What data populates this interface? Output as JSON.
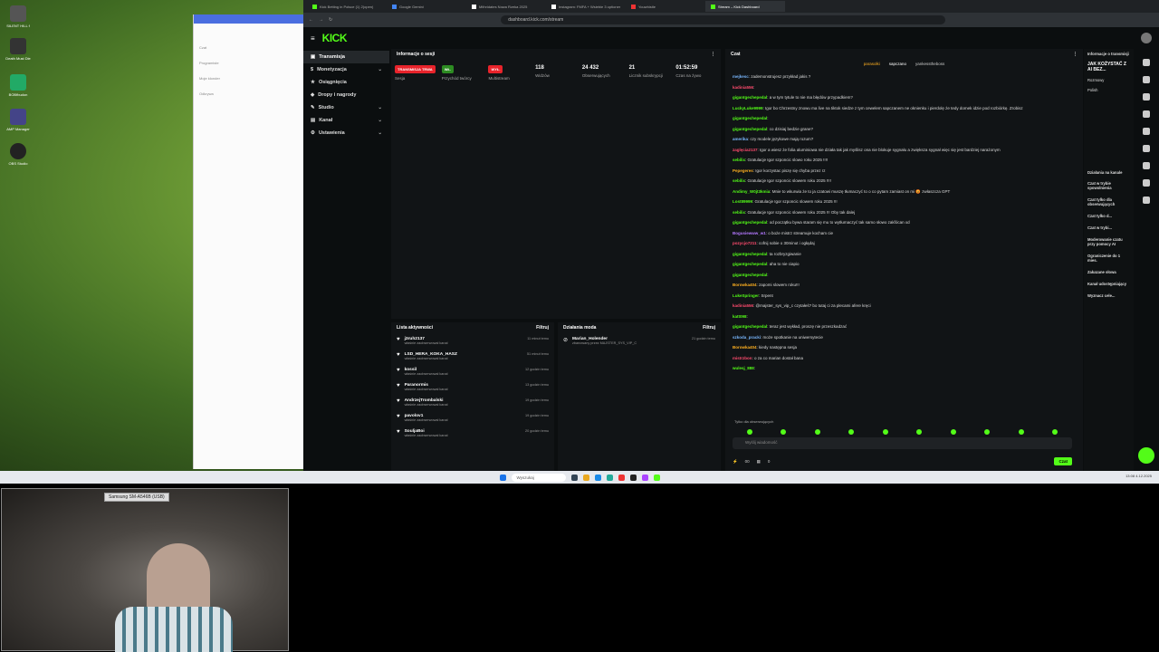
{
  "browser": {
    "tabs": [
      "Kick Betting in Polsce (1) 2(open)",
      "Google Gemini",
      "Mithridates Nowa Rzeka 2025",
      "Instagram: FMFA + Wsiebie 3 optioner",
      "Youwhistle",
      "Stream – Kick Dashboard"
    ],
    "url": "dashboard.kick.com/stream"
  },
  "nav": {
    "items": [
      {
        "label": "Transmisja",
        "chevron": ""
      },
      {
        "label": "Monetyzacja",
        "chevron": "⌄"
      },
      {
        "label": "Osiągnięcia",
        "chevron": ""
      },
      {
        "label": "Dropy i nagrody",
        "chevron": ""
      },
      {
        "label": "Studio",
        "chevron": "⌄"
      },
      {
        "label": "Kanał",
        "chevron": "⌄"
      },
      {
        "label": "Ustawienia",
        "chevron": "⌄"
      }
    ]
  },
  "session": {
    "title": "Informacje o sesji",
    "stats": [
      {
        "pill": "TRANSMISJA TRWA",
        "pill_color": "#e8232b",
        "value": "",
        "label": "Sesja"
      },
      {
        "pill": "WŁ.",
        "pill_color": "#2d8c22",
        "value": "",
        "label": "Przychód twórcy"
      },
      {
        "pill": "WYŁ.",
        "pill_color": "#e8232b",
        "value": "",
        "label": "Multistream"
      },
      {
        "pill": "",
        "pill_color": "",
        "value": "118",
        "label": "Widzów"
      },
      {
        "pill": "",
        "pill_color": "",
        "value": "24 432",
        "label": "Obserwujących"
      },
      {
        "pill": "",
        "pill_color": "",
        "value": "21",
        "label": "Licznik subskrypcji"
      },
      {
        "pill": "",
        "pill_color": "",
        "value": "01:52:59",
        "label": "Czas na żywo"
      }
    ]
  },
  "activity": {
    "title": "Lista aktywności",
    "filter": "Filtruj",
    "items": [
      {
        "name": "j3ruh2137",
        "sub": "właśnie zaobserwował kanał",
        "time": "11 minut temu"
      },
      {
        "name": "LSD_HERA_KOKA_HASZ",
        "sub": "właśnie zaobserwował kanał",
        "time": "51 minut temu"
      },
      {
        "name": "kossil",
        "sub": "właśnie zaobserwował kanał",
        "time": "12 godzin temu"
      },
      {
        "name": "Paranormis",
        "sub": "właśnie zaobserwował kanał",
        "time": "13 godzin temu"
      },
      {
        "name": "AndrzejTrombalski",
        "sub": "właśnie zaobserwował kanał",
        "time": "19 godzin temu"
      },
      {
        "name": "pavolov1",
        "sub": "właśnie zaobserwował kanał",
        "time": "19 godzin temu"
      },
      {
        "name": "SouljaBoi",
        "sub": "właśnie zaobserwował kanał",
        "time": "20 godzin temu"
      }
    ]
  },
  "mod": {
    "title": "Działania moda",
    "filter": "Filtruj",
    "item": {
      "name": "Marian_Holender",
      "sub": "zbanowany przez MAJSTER_SYS_VIP_C",
      "time": "21 godzin temu"
    }
  },
  "chat": {
    "title": "Czat",
    "pinned": [
      "parasolki",
      "sapczano",
      "yankesstheboss"
    ],
    "messages": [
      {
        "user": "mejkesc",
        "color": "#7ab8ff",
        "text": "zademonstrujesz przykład jakis ?"
      },
      {
        "user": "kadinia556",
        "color": "#ff4b6e",
        "text": ""
      },
      {
        "user": "gigantgechepedal",
        "color": "#53fc18",
        "text": "a w tym tytule to nie ma błędów przypadkiem?"
      },
      {
        "user": "LuckyLuke9999",
        "color": "#53fc18",
        "text": "Igor bo Chrzestny znowu ma live na tiktok siedze z tym cewelem sapczanem ne oknienku i pierdolę że tedy domek idzie pod rozbiórkę. Zrobisz"
      },
      {
        "user": "gigantgechepedal",
        "color": "#53fc18",
        "text": ""
      },
      {
        "user": "gigantgechepedal",
        "color": "#53fc18",
        "text": "co dzisiaj bedzie grane?"
      },
      {
        "user": "amerika",
        "color": "#7ab8ff",
        "text": "czy modele językowe mają rozum?"
      },
      {
        "user": "zaglęcia2137",
        "color": "#ff4b6e",
        "text": "Igor a wiesz że folia aluminiowa nie działa tak jak myślisz ona nie blokuje sygnału a zwiększa sygnał więc się jest bardziej narażonym"
      },
      {
        "user": "sebilix",
        "color": "#53fc18",
        "text": "Gratulacje Igor szponcic slowo roku 2025 !!!!"
      },
      {
        "user": "Pepegeres",
        "color": "#ffb020",
        "text": "Igor korzystac piszę się chyba przez rz"
      },
      {
        "user": "sebilix",
        "color": "#53fc18",
        "text": "Gratulacje Igor szponcic slowem roku 2025 !!!!"
      },
      {
        "user": "Andimy_W0jt3kmia",
        "color": "#53fc18",
        "text": "Mnie to wkurwia że to ja czatowi muszę tłumaczyć to o co pytam zamiast on mi 😡 zwłaszcza GPT"
      },
      {
        "user": "Lost89999",
        "color": "#53fc18",
        "text": "Gratulacje Igor szponcic slowem roku 2025 !!!"
      },
      {
        "user": "sebilix",
        "color": "#53fc18",
        "text": "Gratulacje Igor szponcic slowem roku 2025 !!! Oby tak dalej"
      },
      {
        "user": "gigantgechepedal",
        "color": "#53fc18",
        "text": "od początku bywa staram się mu to wytłumaczyć tak samo słowo zakľócan xd"
      },
      {
        "user": "Bogusiewww_w1",
        "color": "#b478ff",
        "text": "o boże mistrz streamuje kocham cie"
      },
      {
        "user": "pozycjo7211",
        "color": "#ff4b6e",
        "text": "cofnij sobie o 30minut i ogłądaj"
      },
      {
        "user": "gigantgechepedal",
        "color": "#53fc18",
        "text": "ta rozbryzgiwanie"
      },
      {
        "user": "gigantgechepedal",
        "color": "#53fc18",
        "text": "aha to nie ciapio"
      },
      {
        "user": "gigantgechepedal",
        "color": "#53fc18",
        "text": ""
      },
      {
        "user": "Borowka404",
        "color": "#ffb020",
        "text": "zapomi slowem roku!!!"
      },
      {
        "user": "LukeSpringer",
        "color": "#53fc18",
        "text": "Srpent"
      },
      {
        "user": "kadinia556",
        "color": "#ff4b6e",
        "text": "@majster_sys_vip_c czytałeś? bo tutaj ci za plecami afere kręci"
      },
      {
        "user": "katt098",
        "color": "#53fc18",
        "text": ""
      },
      {
        "user": "gigantgechepedal",
        "color": "#53fc18",
        "text": "teraz jest wykład, proszę nie przeszkadzać"
      },
      {
        "user": "szkoda_pracki",
        "color": "#7ab8ff",
        "text": "może spotkanie na uniwersytecie"
      },
      {
        "user": "Borowka404",
        "color": "#ffb020",
        "text": "kiedy następna sesja"
      },
      {
        "user": "mistrzbon",
        "color": "#ff4b6e",
        "text": "o za co marian dostał bana"
      },
      {
        "user": "wulesj_888",
        "color": "#53fc18",
        "text": ""
      }
    ],
    "followers_only": "Tylko dla obserwujących",
    "input_placeholder": "Wyślij wiadomość",
    "count_a": "00",
    "count_b": "0",
    "send_label": "Czat"
  },
  "right_panel": {
    "title": "Informacje o transmisji",
    "stream_title": "JAK KOŻYSTAĆ Z AI BEZ...",
    "category": "Rozmowy",
    "lang": "Polish",
    "section": "Działania na kanale",
    "rows": [
      "Czat w trybie spowolnienia",
      "Czat tylko dla obserwujących",
      "Czat tylko d...",
      "Czat w trybi...",
      "Moderowanie czatu przy pomocy AI",
      "Ograniczenie do 1 mies.",
      "Zakazane słowa",
      "Kanał udostępniający",
      "Wyznacz cele..."
    ]
  },
  "taskbar": {
    "search": "Wyszukaj",
    "time": "13:08",
    "date": "4.12.2025"
  },
  "webcam": {
    "label": "Samsung SM-A546B (USB)"
  },
  "desktop_icons": [
    "SILENT HILL f",
    "Death Must Die",
    "BOBfbudon",
    "AMP Manager",
    "OBS Studio"
  ],
  "colors": {
    "accent": "#53fc18",
    "live": "#e8232b"
  }
}
